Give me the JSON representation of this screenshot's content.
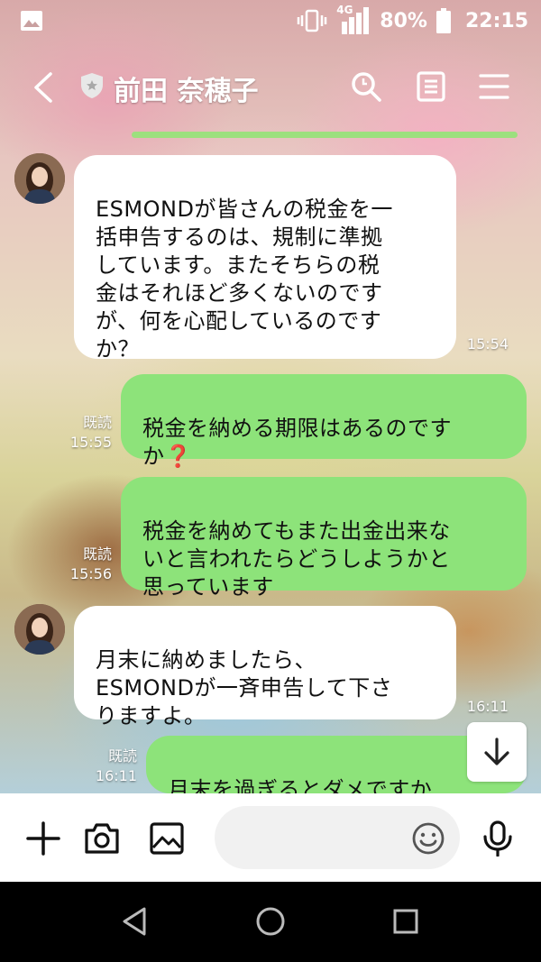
{
  "status_bar": {
    "network": "4G",
    "battery": "80%",
    "time": "22:15"
  },
  "header": {
    "title": "前田 奈穂子"
  },
  "messages": [
    {
      "direction": "in",
      "text": "ESMONDが皆さんの税金を一\n括申告するのは、規制に準拠\nしています。またそちらの税\n金はそれほど多くないのです\nが、何を心配しているのです\nか？",
      "time": "15:54"
    },
    {
      "direction": "out",
      "text": "税金を納める期限はあるのです\nか",
      "emoji": "❓",
      "read": "既読",
      "time": "15:55"
    },
    {
      "direction": "out",
      "text": "税金を納めてもまた出金出来な\nいと言われたらどうしようかと\n思っています",
      "read": "既読",
      "time": "15:56"
    },
    {
      "direction": "in",
      "text": "月末に納めましたら、\nESMONDが一斉申告して下さ\nりますよ。",
      "time": "16:11"
    },
    {
      "direction": "out",
      "text": "月末を過ぎるとダメですか",
      "read": "既読",
      "time": "16:11"
    }
  ],
  "input": {
    "placeholder": ""
  },
  "colors": {
    "outgoing_bubble": "#8de37a",
    "incoming_bubble": "#ffffff",
    "accent_line": "#9ce07e"
  }
}
